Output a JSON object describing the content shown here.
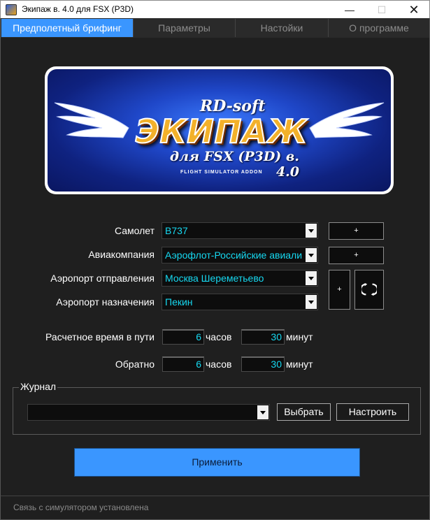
{
  "window": {
    "title": "Экипаж в. 4.0 для FSX (P3D)",
    "minimize": "—",
    "maximize": "☐",
    "close": "✕"
  },
  "tabs": [
    {
      "label": "Предполетный брифинг",
      "active": true
    },
    {
      "label": "Параметры",
      "active": false
    },
    {
      "label": "Настойки",
      "active": false
    },
    {
      "label": "О программе",
      "active": false
    }
  ],
  "banner": {
    "brand": "RD-soft",
    "title": "ЭКИПАЖ",
    "subtitle": "для FSX (P3D) в. 4.0",
    "tagline": "FLIGHT SIMULATOR ADDON"
  },
  "form": {
    "aircraft": {
      "label": "Самолет",
      "value": "B737",
      "add": "+"
    },
    "airline": {
      "label": "Авиакомпания",
      "value": "Аэрофлот-Российские авиали",
      "add": "+"
    },
    "departure": {
      "label": "Аэропорт отправления",
      "value": "Москва Шереметьево"
    },
    "arrival": {
      "label": "Аэропорт назначения",
      "value": "Пекин"
    },
    "airport_add": "+",
    "swap_icon": "swap-arrows-icon"
  },
  "times": {
    "en_route": {
      "label": "Расчетное время в пути",
      "hours": "6",
      "hours_unit": "часов",
      "minutes": "30",
      "minutes_unit": "минут"
    },
    "return": {
      "label": "Обратно",
      "hours": "6",
      "hours_unit": "часов",
      "minutes": "30",
      "minutes_unit": "минут"
    }
  },
  "journal": {
    "title": "Журнал",
    "value": "",
    "select_label": "Выбрать",
    "configure_label": "Настроить"
  },
  "apply_label": "Применить",
  "status": "Связь с симулятором установлена",
  "colors": {
    "accent": "#3a96ff",
    "value_text": "#16d8f0",
    "background": "#1f1f1f"
  }
}
